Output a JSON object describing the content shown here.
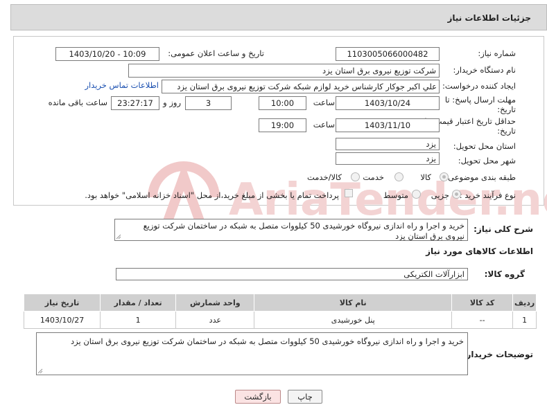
{
  "header": {
    "title": "جزئیات اطلاعات نیاز"
  },
  "form": {
    "need_number_label": "شماره نیاز:",
    "need_number": "1103005066000482",
    "announce_label": "تاریخ و ساعت اعلان عمومی:",
    "announce_value": "1403/10/20 - 10:09",
    "buyer_org_label": "نام دستگاه خریدار:",
    "buyer_org": "شرکت توزیع نیروی برق استان یزد",
    "creator_label": "ایجاد کننده درخواست:",
    "creator": "علي اکبر  جوکار  کارشناس خرید لوازم شبکه  شرکت توزیع نیروی برق استان یزد",
    "buyer_contact_link": "اطلاعات تماس خریدار",
    "reply_deadline_label_1": "مهلت ارسال پاسخ: تا",
    "reply_deadline_label_2": "تاریخ:",
    "reply_date": "1403/10/24",
    "time_label": "ساعت",
    "reply_time": "10:00",
    "days": "3",
    "days_label": "روز و",
    "remaining_time": "23:27:17",
    "remaining_label": "ساعت باقی مانده",
    "price_validity_label_1": "حداقل تاریخ اعتبار قیمت: تا",
    "price_validity_label_2": "تاریخ:",
    "validity_date": "1403/11/10",
    "validity_time_label": "ساعت",
    "validity_time": "19:00",
    "province_label": "استان محل تحویل:",
    "province": "یزد",
    "city_label": "شهر محل تحویل:",
    "city": "یزد",
    "category_label": "طبقه بندی موضوعی:",
    "category_options": [
      "کالا",
      "خدمت",
      "کالا/خدمت"
    ],
    "process_label": "نوع فرآیند خرید :",
    "process_options": [
      "جزیی",
      "متوسط"
    ],
    "payment_text": "پرداخت تمام یا بخشی از مبلغ خرید،از محل \"اسناد خزانه اسلامی\" خواهد بود."
  },
  "description": {
    "label": "شرح کلی نیاز:",
    "text": "خرید و اجرا و راه اندازی نیروگاه خورشیدی 50 کیلووات متصل به شبکه در ساختمان شرکت توزیع نیروی برق استان یزد"
  },
  "goods": {
    "section_title": "اطلاعات کالاهای مورد نیاز",
    "group_label": "گروه کالا:",
    "group_value": "ابزارآلات الکتریکی",
    "columns": [
      "ردیف",
      "کد کالا",
      "نام کالا",
      "واحد شمارش",
      "تعداد / مقدار",
      "تاریخ نیاز"
    ],
    "rows": [
      {
        "row": "1",
        "code": "--",
        "name": "پنل خورشیدی",
        "unit": "عدد",
        "qty": "1",
        "date": "1403/10/27"
      }
    ]
  },
  "buyer_notes": {
    "label": "توضیحات خریدار:",
    "text": "خرید و اجرا و راه اندازی نیروگاه خورشیدی 50 کیلووات متصل به شبکه در ساختمان شرکت توزیع نیروی برق استان یزد"
  },
  "buttons": {
    "print": "چاپ",
    "back": "بازگشت"
  },
  "watermark": {
    "text": "AriaTender.neT"
  }
}
